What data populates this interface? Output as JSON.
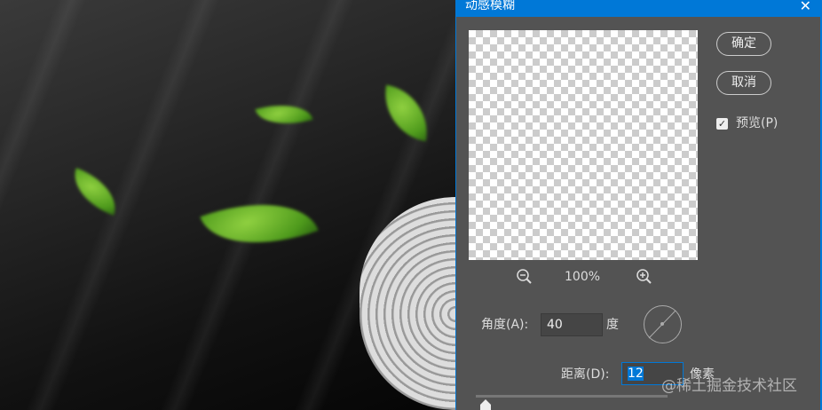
{
  "dialog": {
    "title": "动感模糊",
    "close": "✕",
    "ok_label": "确定",
    "cancel_label": "取消",
    "preview_label": "预览(P)",
    "preview_checked": true,
    "check_glyph": "✓",
    "zoom_out_icon": "zoom-out-icon",
    "zoom_in_icon": "zoom-in-icon",
    "zoom_level": "100%",
    "angle_label": "角度(A):",
    "angle_value": "40",
    "angle_unit": "度",
    "distance_label": "距离(D):",
    "distance_value": "12",
    "distance_unit": "像素"
  },
  "watermark": "@稀土掘金技术社区"
}
